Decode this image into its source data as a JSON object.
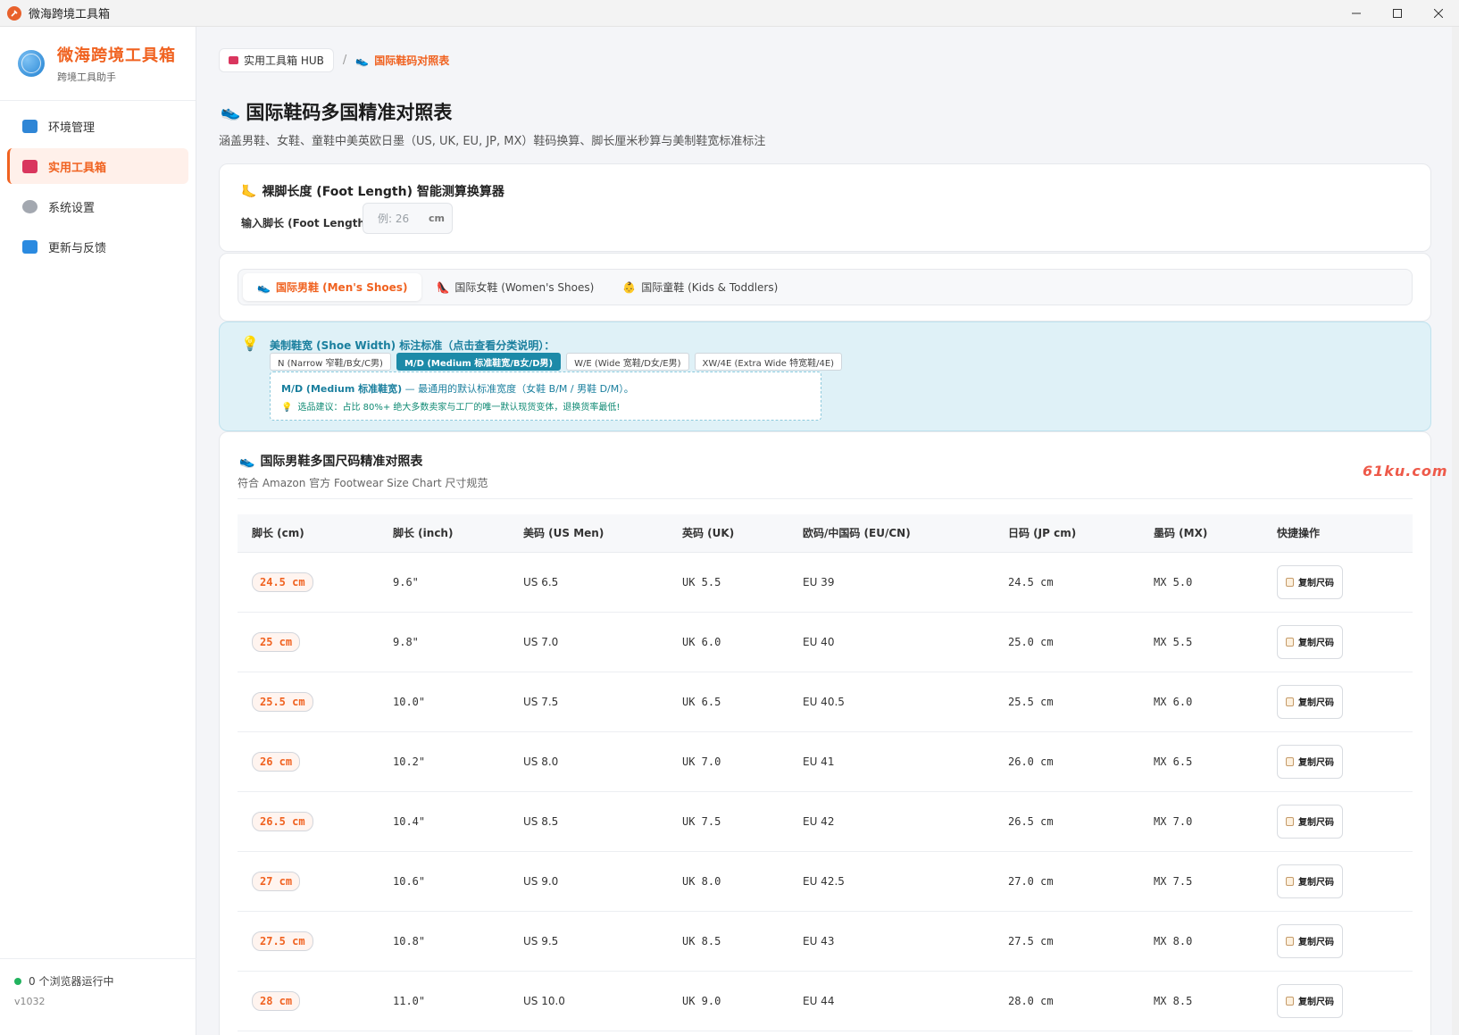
{
  "window": {
    "title": "微海跨境工具箱"
  },
  "sidebar": {
    "brand_name": "微海跨境工具箱",
    "brand_sub": "跨境工具助手",
    "items": [
      {
        "label": "环境管理",
        "icon": "laptop-icon"
      },
      {
        "label": "实用工具箱",
        "icon": "toolbox-icon"
      },
      {
        "label": "系统设置",
        "icon": "gear-icon"
      },
      {
        "label": "更新与反馈",
        "icon": "refresh-icon"
      }
    ],
    "status": "0 个浏览器运行中",
    "version": "v1032"
  },
  "breadcrumb": {
    "hub": "实用工具箱 HUB",
    "sep": "/",
    "current": "国际鞋码对照表"
  },
  "page": {
    "title": "国际鞋码多国精准对照表",
    "subtitle": "涵盖男鞋、女鞋、童鞋中美英欧日墨（US, UK, EU, JP, MX）鞋码换算、脚长厘米秒算与美制鞋宽标准标注"
  },
  "calculator": {
    "title": "裸脚长度 (Foot Length) 智能测算换算器",
    "label": "输入脚长 (Foot Length):",
    "placeholder": "例: 26",
    "unit": "cm"
  },
  "tabs": [
    {
      "label": "国际男鞋 (Men's Shoes)",
      "active": true
    },
    {
      "label": "国际女鞋 (Women's Shoes)",
      "active": false
    },
    {
      "label": "国际童鞋 (Kids & Toddlers)",
      "active": false
    }
  ],
  "width_info": {
    "title": "美制鞋宽 (Shoe Width) 标注标准（点击查看分类说明）：",
    "options": [
      {
        "label": "N (Narrow 窄鞋/B女/C男)",
        "active": false
      },
      {
        "label": "M/D (Medium 标准鞋宽/B女/D男)",
        "active": true
      },
      {
        "label": "W/E (Wide 宽鞋/D女/E男)",
        "active": false
      },
      {
        "label": "XW/4E (Extra Wide 特宽鞋/4E)",
        "active": false
      }
    ],
    "detail_name": "M/D (Medium 标准鞋宽)",
    "detail_text": " — 最通用的默认标准宽度（女鞋 B/M / 男鞋 D/M）。",
    "tip": "选品建议：占比 80%+ 绝大多数卖家与工厂的唯一默认现货变体，退换货率最低!"
  },
  "table": {
    "title": "国际男鞋多国尺码精准对照表",
    "subtitle": "符合 Amazon 官方 Footwear Size Chart 尺寸规范",
    "headers": [
      "脚长 (cm)",
      "脚长 (inch)",
      "美码 (US Men)",
      "英码 (UK)",
      "欧码/中国码 (EU/CN)",
      "日码 (JP cm)",
      "墨码 (MX)",
      "快捷操作"
    ],
    "copy_label": "复制尺码",
    "rows": [
      [
        "24.5 cm",
        "9.6\"",
        "US 6.5",
        "UK 5.5",
        "EU 39",
        "24.5 cm",
        "MX 5.0"
      ],
      [
        "25 cm",
        "9.8\"",
        "US 7.0",
        "UK 6.0",
        "EU 40",
        "25.0 cm",
        "MX 5.5"
      ],
      [
        "25.5 cm",
        "10.0\"",
        "US 7.5",
        "UK 6.5",
        "EU 40.5",
        "25.5 cm",
        "MX 6.0"
      ],
      [
        "26 cm",
        "10.2\"",
        "US 8.0",
        "UK 7.0",
        "EU 41",
        "26.0 cm",
        "MX 6.5"
      ],
      [
        "26.5 cm",
        "10.4\"",
        "US 8.5",
        "UK 7.5",
        "EU 42",
        "26.5 cm",
        "MX 7.0"
      ],
      [
        "27 cm",
        "10.6\"",
        "US 9.0",
        "UK 8.0",
        "EU 42.5",
        "27.0 cm",
        "MX 7.5"
      ],
      [
        "27.5 cm",
        "10.8\"",
        "US 9.5",
        "UK 8.5",
        "EU 43",
        "27.5 cm",
        "MX 8.0"
      ],
      [
        "28 cm",
        "11.0\"",
        "US 10.0",
        "UK 9.0",
        "EU 44",
        "28.0 cm",
        "MX 8.5"
      ]
    ]
  },
  "watermark": "61ku.com",
  "colors": {
    "accent": "#f06220",
    "info": "#1a7f9e",
    "status_ok": "#22b35e"
  }
}
